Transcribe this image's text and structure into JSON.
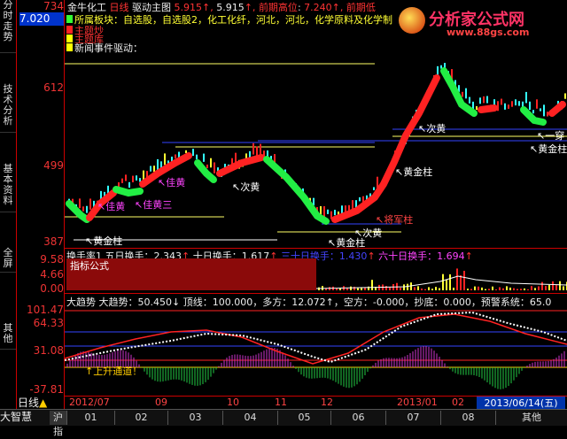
{
  "header": {
    "stock_name": "金牛化工",
    "period_name": "日线",
    "indicator_name": "驱动主图",
    "value_a": "5.915",
    "value_b": "5.915",
    "last_label": "前期高位",
    "last_value": "7.240",
    "tail": "前期低"
  },
  "watermark": {
    "title": "分析家公式网",
    "url": "www.88gs.com"
  },
  "price_cursor": "7.020",
  "price_axis": [
    "734",
    "612",
    "499",
    "387"
  ],
  "legend": {
    "sector_line": "所属板块：自选股，自选股2，化工化纤，河北，河北，化学原料及化学制",
    "lines": [
      "主题炒",
      "主题库",
      "新闻事件驱动："
    ]
  },
  "annotations": [
    {
      "text": "↖黄金柱",
      "color": "#ffffff"
    },
    {
      "text": "↖佳黄",
      "color": "#ff44ff"
    },
    {
      "text": "↖佳黄三",
      "color": "#ff44ff"
    },
    {
      "text": "↖佳黄",
      "color": "#ff44ff"
    },
    {
      "text": "↖次黄",
      "color": "#ffffff"
    },
    {
      "text": "↖将军柱",
      "color": "#ff4444"
    },
    {
      "text": "↖次黄",
      "color": "#ffffff"
    },
    {
      "text": "↖黄金柱",
      "color": "#ffffff"
    },
    {
      "text": "↖黄金柱",
      "color": "#ffffff"
    },
    {
      "text": "↖次黄",
      "color": "#ffffff"
    },
    {
      "text": "↖黄金柱",
      "color": "#ffffff"
    },
    {
      "text": "↖一穿",
      "color": "#ffffff"
    }
  ],
  "turnover": {
    "title": "换手率1",
    "five_day": "五日换手：2.343",
    "ten_day": "十日换手：1.617",
    "thirty_day": "三十日换手：1.430",
    "sixty_day": "六十日换手：1.694",
    "axis": [
      "9.58",
      "4.66",
      "0.00"
    ],
    "formula_label": "指标公式"
  },
  "trend": {
    "title": "大趋势",
    "values_line": "大趋势：50.450↓ 顶线：100.000，多方：12.072↑，空方：-0.000，抄底：0.000，预警系统：65.0",
    "axis": [
      "101.47",
      "64.33",
      "31.08",
      "-37.81"
    ],
    "channel_label": "上升通道",
    "channel_prefix": "↑"
  },
  "x_axis": {
    "labels": [
      "2012/07",
      "09",
      "10",
      "11",
      "12",
      "2013/01",
      "02"
    ],
    "date_box": "2013/06/14(五)"
  },
  "side_tabs": [
    "分时走势",
    "技术分析",
    "基本资料",
    "全屏",
    "其他"
  ],
  "bottom_bar": {
    "app_name": "大智慧",
    "period": "日线",
    "tabs": [
      "沪指",
      "01",
      "02",
      "03",
      "04",
      "05",
      "06",
      "07",
      "08",
      "其他"
    ]
  },
  "colors": {
    "up": "#ff2222",
    "down": "#22ee44",
    "accent": "#ffff00",
    "blue_line": "#3344ff"
  }
}
